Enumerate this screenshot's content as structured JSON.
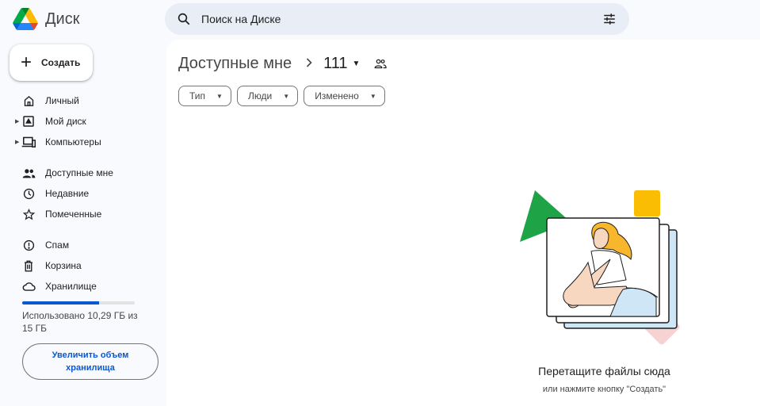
{
  "app": {
    "title": "Диск",
    "colors": {
      "accent": "#0b57d0",
      "sidebar_bg": "#f8fafd",
      "search_bg": "#e9eef6"
    }
  },
  "search": {
    "placeholder": "Поиск на Диске",
    "value": ""
  },
  "sidebar": {
    "create_label": "Создать",
    "items": [
      {
        "label": "Личный",
        "icon": "home-icon",
        "expandable": false
      },
      {
        "label": "Мой диск",
        "icon": "my-drive-icon",
        "expandable": true
      },
      {
        "label": "Компьютеры",
        "icon": "computers-icon",
        "expandable": true
      },
      {
        "label": "Доступные мне",
        "icon": "shared-people-icon",
        "expandable": false
      },
      {
        "label": "Недавние",
        "icon": "clock-icon",
        "expandable": false
      },
      {
        "label": "Помеченные",
        "icon": "star-icon",
        "expandable": false
      },
      {
        "label": "Спам",
        "icon": "spam-icon",
        "expandable": false
      },
      {
        "label": "Корзина",
        "icon": "trash-icon",
        "expandable": false
      },
      {
        "label": "Хранилище",
        "icon": "cloud-icon",
        "expandable": false
      }
    ],
    "storage": {
      "used_fraction": 0.686,
      "text": "Использовано 10,29 ГБ из 15 ГБ",
      "upgrade_label": "Увеличить объем хранилища"
    }
  },
  "main": {
    "breadcrumb": {
      "root": "Доступные мне",
      "current": "111"
    },
    "filters": [
      {
        "label": "Тип"
      },
      {
        "label": "Люди"
      },
      {
        "label": "Изменено"
      }
    ],
    "empty": {
      "title": "Перетащите файлы сюда",
      "subtitle": "или нажмите кнопку \"Создать\""
    }
  }
}
